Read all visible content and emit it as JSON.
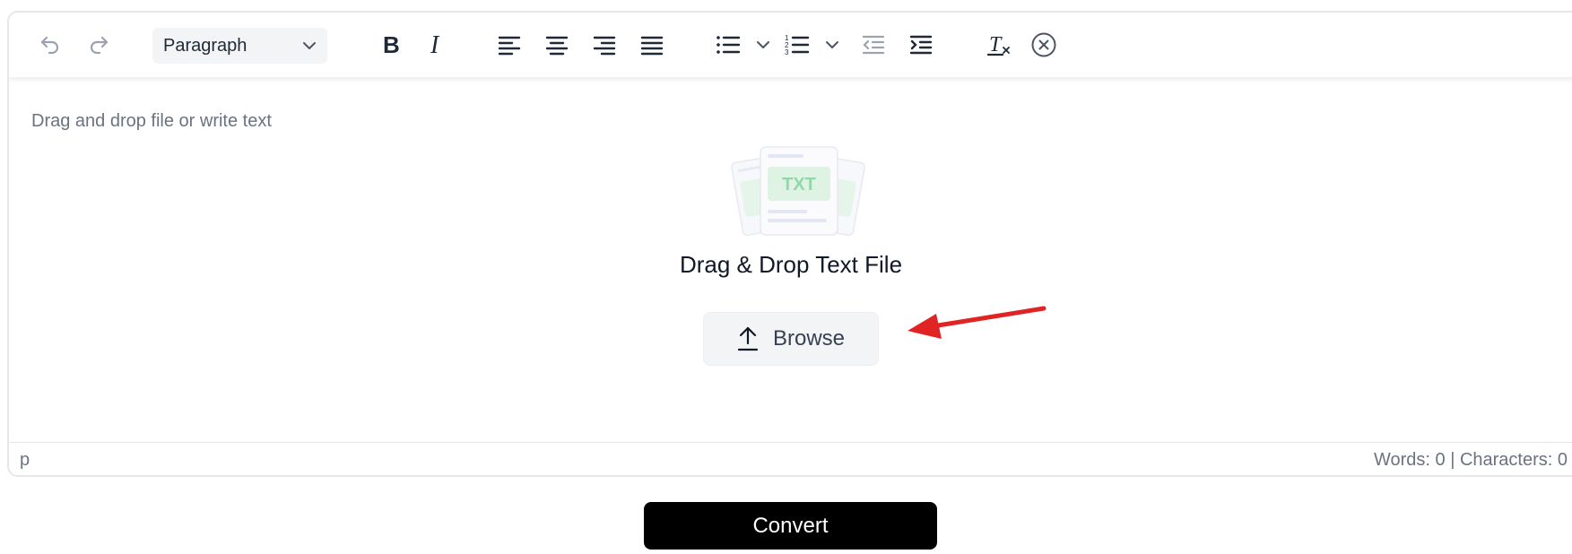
{
  "toolbar": {
    "format_value": "Paragraph",
    "icons": [
      "undo-icon",
      "redo-icon",
      "chevron-down-icon",
      "bold-icon",
      "italic-icon",
      "align-left-icon",
      "align-center-icon",
      "align-right-icon",
      "align-justify-icon",
      "bullet-list-icon",
      "numbered-list-icon",
      "outdent-icon",
      "indent-icon",
      "clear-formatting-icon",
      "close-circle-icon"
    ]
  },
  "editor": {
    "placeholder": "Drag and drop file or write text",
    "illustration_label": "TXT",
    "drop_title": "Drag & Drop Text File",
    "browse_label": "Browse"
  },
  "statusbar": {
    "path": "p",
    "counts": "Words: 0 | Characters: 0"
  },
  "actions": {
    "convert_label": "Convert"
  },
  "colors": {
    "arrow": "#e02424",
    "illustration_green": "#86d3a0",
    "button_bg": "#f3f4f6",
    "primary": "#000000"
  }
}
